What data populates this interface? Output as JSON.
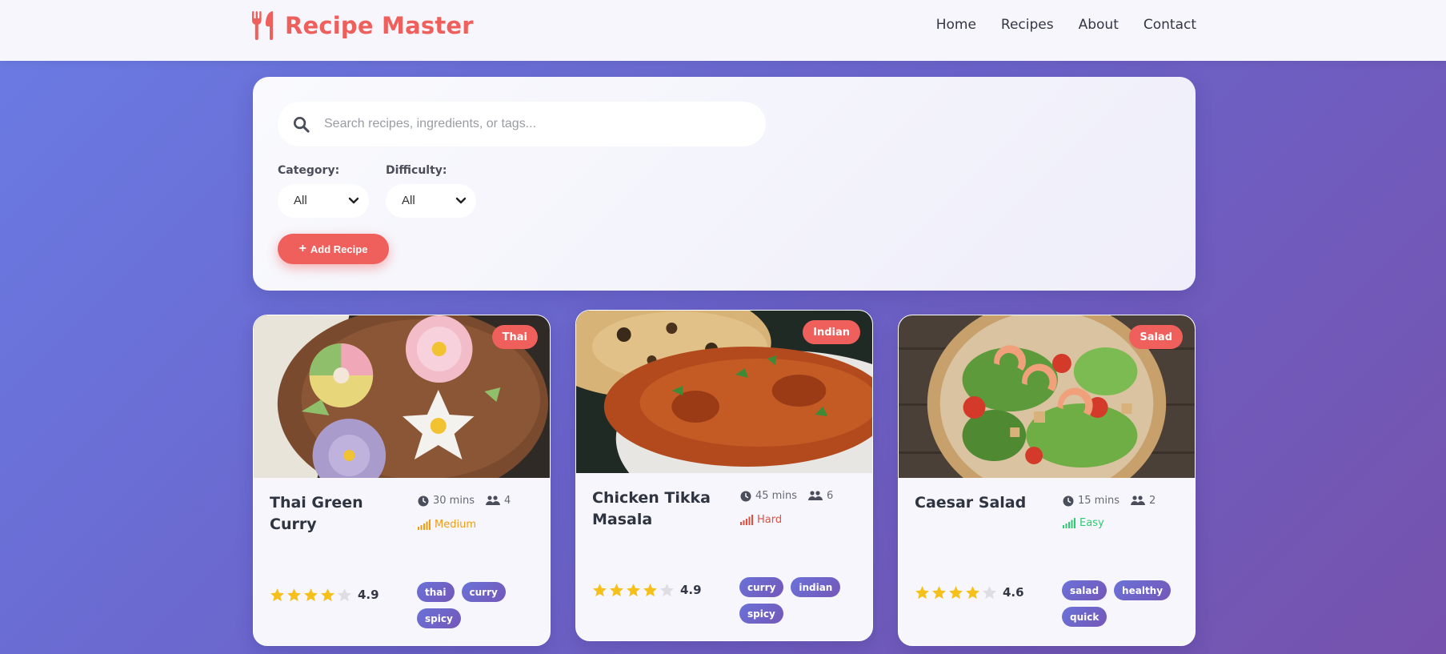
{
  "header": {
    "brand_name": "Recipe Master",
    "nav": [
      "Home",
      "Recipes",
      "About",
      "Contact"
    ]
  },
  "search": {
    "placeholder": "Search recipes, ingredients, or tags...",
    "value": ""
  },
  "filters": {
    "category_label": "Category:",
    "category_value": "All",
    "difficulty_label": "Difficulty:",
    "difficulty_value": "All"
  },
  "add_button_label": "Add Recipe",
  "recipes": [
    {
      "title": "Thai Green Curry",
      "category": "Thai",
      "time": "30 mins",
      "servings": "4",
      "difficulty": "Medium",
      "difficulty_color": "#f39c12",
      "rating": "4.9",
      "stars_filled": 4,
      "tags": [
        "thai",
        "curry",
        "spicy"
      ]
    },
    {
      "title": "Chicken Tikka Masala",
      "category": "Indian",
      "time": "45 mins",
      "servings": "6",
      "difficulty": "Hard",
      "difficulty_color": "#e74c3c",
      "rating": "4.9",
      "stars_filled": 4,
      "tags": [
        "curry",
        "indian",
        "spicy"
      ]
    },
    {
      "title": "Caesar Salad",
      "category": "Salad",
      "time": "15 mins",
      "servings": "2",
      "difficulty": "Easy",
      "difficulty_color": "#2ecc71",
      "rating": "4.6",
      "stars_filled": 4,
      "tags": [
        "salad",
        "healthy",
        "quick"
      ]
    }
  ],
  "colors": {
    "accent": "#ef5f5b",
    "star": "#f6c01b",
    "star_empty": "#dddde3",
    "tag_gradient_start": "#6a72d8",
    "tag_gradient_end": "#7457b8"
  }
}
